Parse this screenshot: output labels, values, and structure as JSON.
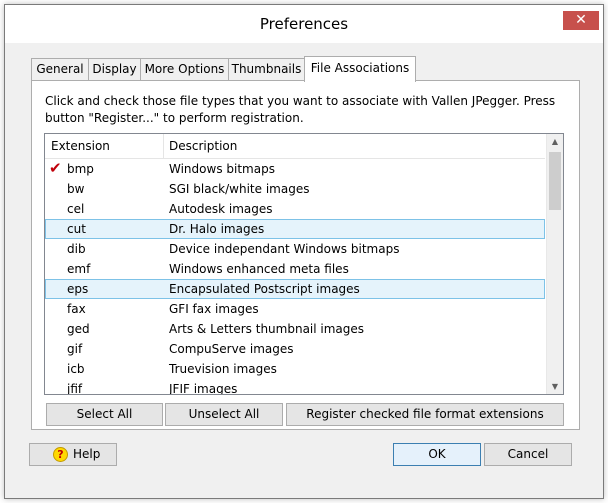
{
  "window": {
    "title": "Preferences",
    "close_glyph": "✕"
  },
  "tabs": [
    {
      "label": "General"
    },
    {
      "label": "Display"
    },
    {
      "label": "More Options"
    },
    {
      "label": "Thumbnails"
    },
    {
      "label": "File Associations",
      "active": true
    }
  ],
  "panel": {
    "intro_line1": "Click and check those file types that you want to associate with Vallen JPegger. Press",
    "intro_line2": "button \"Register...\" to perform registration.",
    "columns": {
      "extension": "Extension",
      "description": "Description"
    },
    "rows": [
      {
        "ext": "bmp",
        "desc": "Windows bitmaps",
        "checked": true
      },
      {
        "ext": "bw",
        "desc": "SGI black/white images"
      },
      {
        "ext": "cel",
        "desc": "Autodesk images"
      },
      {
        "ext": "cut",
        "desc": "Dr. Halo images",
        "highlighted": true
      },
      {
        "ext": "dib",
        "desc": "Device independant Windows bitmaps"
      },
      {
        "ext": "emf",
        "desc": "Windows enhanced meta files"
      },
      {
        "ext": "eps",
        "desc": "Encapsulated Postscript images",
        "highlighted": true
      },
      {
        "ext": "fax",
        "desc": "GFI fax images"
      },
      {
        "ext": "ged",
        "desc": "Arts & Letters thumbnail images"
      },
      {
        "ext": "gif",
        "desc": "CompuServe images"
      },
      {
        "ext": "icb",
        "desc": "Truevision images"
      },
      {
        "ext": "jfif",
        "desc": "JFIF images"
      }
    ],
    "check_glyph": "✔",
    "select_all": "Select All",
    "unselect_all": "Unselect All",
    "register": "Register checked file format extensions"
  },
  "footer": {
    "help": "Help",
    "help_icon_glyph": "?",
    "ok": "OK",
    "cancel": "Cancel"
  },
  "colors": {
    "check": "#c0000a",
    "highlight_bg": "#e5f3fb",
    "highlight_border": "#7dc2e7"
  }
}
